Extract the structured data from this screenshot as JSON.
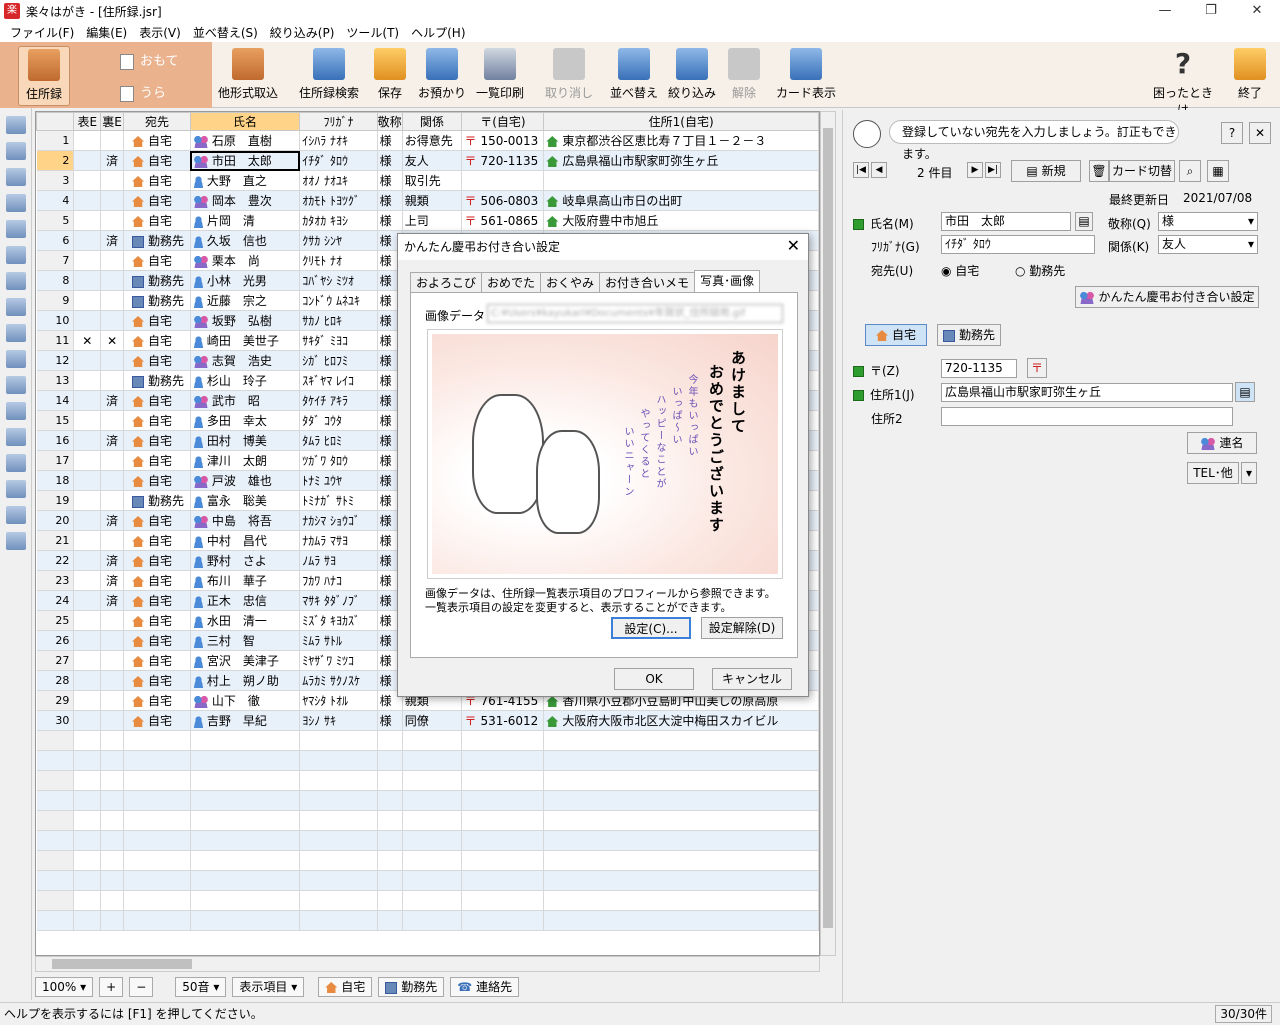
{
  "window": {
    "title": "楽々はがき - [住所録.jsr]",
    "min": "—",
    "max": "❐",
    "close": "✕"
  },
  "menu": [
    "ファイル(F)",
    "編集(E)",
    "表示(V)",
    "並べ替え(S)",
    "絞り込み(P)",
    "ツール(T)",
    "ヘルプ(H)"
  ],
  "ribbon": {
    "jusho": "住所録",
    "omote": "おもて",
    "ura": "うら",
    "tagata": "他形式取込",
    "kensaku": "住所録検索",
    "hozon": "保存",
    "oazukari": "お預かり",
    "ichiran": "一覧印刷",
    "torikeshi": "取り消し",
    "narabekae": "並べ替え",
    "shiborikomi": "絞り込み",
    "kaijo": "解除",
    "card": "カード表示",
    "komatta": "困ったときは",
    "shuryo": "終了"
  },
  "grid": {
    "headers": [
      "",
      "表E",
      "裏E",
      "宛先",
      "氏名",
      "ﾌﾘｶﾞﾅ",
      "敬称",
      "関係",
      "〒(自宅)",
      "住所1(自宅)"
    ],
    "rows": [
      {
        "n": "1",
        "omote": "",
        "ura": "",
        "dest": "自宅",
        "dtype": "h",
        "pt": "g",
        "name": "石原　直樹",
        "kana": "ｲｼﾊﾗ ﾅｵｷ",
        "hon": "様",
        "rel": "お得意先",
        "zip": "150-0013",
        "addr": "東京都渋谷区恵比寿７丁目１－２－３"
      },
      {
        "n": "2",
        "omote": "",
        "ura": "済",
        "dest": "自宅",
        "dtype": "h",
        "pt": "g",
        "name": "市田　太郎",
        "kana": "ｲﾁﾀﾞ ﾀﾛｳ",
        "hon": "様",
        "rel": "友人",
        "zip": "720-1135",
        "addr": "広島県福山市駅家町弥生ヶ丘"
      },
      {
        "n": "3",
        "omote": "",
        "ura": "",
        "dest": "自宅",
        "dtype": "h",
        "pt": "m",
        "name": "大野　直之",
        "kana": "ｵｵﾉ ﾅｵﾕｷ",
        "hon": "様",
        "rel": "取引先",
        "zip": "",
        "addr": ""
      },
      {
        "n": "4",
        "omote": "",
        "ura": "",
        "dest": "自宅",
        "dtype": "h",
        "pt": "g",
        "name": "岡本　豊次",
        "kana": "ｵｶﾓﾄ ﾄﾖﾂｸﾞ",
        "hon": "様",
        "rel": "親類",
        "zip": "506-0803",
        "addr": "岐阜県高山市日の出町"
      },
      {
        "n": "5",
        "omote": "",
        "ura": "",
        "dest": "自宅",
        "dtype": "h",
        "pt": "m",
        "name": "片岡　清",
        "kana": "ｶﾀｵｶ ｷﾖｼ",
        "hon": "様",
        "rel": "上司",
        "zip": "561-0865",
        "addr": "大阪府豊中市旭丘"
      },
      {
        "n": "6",
        "omote": "",
        "ura": "済",
        "dest": "勤務先",
        "dtype": "w",
        "pt": "m",
        "name": "久坂　信也",
        "kana": "ｸｻｶ ｼﾝﾔ",
        "hon": "様",
        "rel": "",
        "zip": "",
        "addr": ""
      },
      {
        "n": "7",
        "omote": "",
        "ura": "",
        "dest": "自宅",
        "dtype": "h",
        "pt": "g",
        "name": "栗本　尚",
        "kana": "ｸﾘﾓﾄ ﾅｵ",
        "hon": "様",
        "rel": "",
        "zip": "",
        "addr": ""
      },
      {
        "n": "8",
        "omote": "",
        "ura": "",
        "dest": "勤務先",
        "dtype": "w",
        "pt": "m",
        "name": "小林　光男",
        "kana": "ｺﾊﾞﾔｼ ﾐﾂｵ",
        "hon": "様",
        "rel": "",
        "zip": "",
        "addr": ""
      },
      {
        "n": "9",
        "omote": "",
        "ura": "",
        "dest": "勤務先",
        "dtype": "w",
        "pt": "m",
        "name": "近藤　宗之",
        "kana": "ｺﾝﾄﾞｳ ﾑﾈﾕｷ",
        "hon": "様",
        "rel": "",
        "zip": "",
        "addr": ""
      },
      {
        "n": "10",
        "omote": "",
        "ura": "",
        "dest": "自宅",
        "dtype": "h",
        "pt": "g",
        "name": "坂野　弘樹",
        "kana": "ｻｶﾉ ﾋﾛｷ",
        "hon": "様",
        "rel": "",
        "zip": "",
        "addr": ""
      },
      {
        "n": "11",
        "omote": "✕",
        "ura": "✕",
        "dest": "自宅",
        "dtype": "h",
        "pt": "m",
        "name": "崎田　美世子",
        "kana": "ｻｷﾀﾞ ﾐﾖｺ",
        "hon": "様",
        "rel": "",
        "zip": "",
        "addr": ""
      },
      {
        "n": "12",
        "omote": "",
        "ura": "",
        "dest": "自宅",
        "dtype": "h",
        "pt": "g",
        "name": "志賀　浩史",
        "kana": "ｼｶﾞ ﾋﾛﾌﾐ",
        "hon": "様",
        "rel": "",
        "zip": "",
        "addr": ""
      },
      {
        "n": "13",
        "omote": "",
        "ura": "",
        "dest": "勤務先",
        "dtype": "w",
        "pt": "m",
        "name": "杉山　玲子",
        "kana": "ｽｷﾞﾔﾏ ﾚｲｺ",
        "hon": "様",
        "rel": "",
        "zip": "",
        "addr": ""
      },
      {
        "n": "14",
        "omote": "",
        "ura": "済",
        "dest": "自宅",
        "dtype": "h",
        "pt": "g",
        "name": "武市　昭",
        "kana": "ﾀｹｲﾁ ｱｷﾗ",
        "hon": "様",
        "rel": "",
        "zip": "",
        "addr": ""
      },
      {
        "n": "15",
        "omote": "",
        "ura": "",
        "dest": "自宅",
        "dtype": "h",
        "pt": "m",
        "name": "多田　幸太",
        "kana": "ﾀﾀﾞ ｺｳﾀ",
        "hon": "様",
        "rel": "",
        "zip": "",
        "addr": ""
      },
      {
        "n": "16",
        "omote": "",
        "ura": "済",
        "dest": "自宅",
        "dtype": "h",
        "pt": "m",
        "name": "田村　博美",
        "kana": "ﾀﾑﾗ ﾋﾛﾐ",
        "hon": "様",
        "rel": "",
        "zip": "",
        "addr": ""
      },
      {
        "n": "17",
        "omote": "",
        "ura": "",
        "dest": "自宅",
        "dtype": "h",
        "pt": "m",
        "name": "津川　太朗",
        "kana": "ﾂｶﾞﾜ ﾀﾛｳ",
        "hon": "様",
        "rel": "",
        "zip": "",
        "addr": ""
      },
      {
        "n": "18",
        "omote": "",
        "ura": "",
        "dest": "自宅",
        "dtype": "h",
        "pt": "g",
        "name": "戸波　雄也",
        "kana": "ﾄﾅﾐ ﾕｳﾔ",
        "hon": "様",
        "rel": "",
        "zip": "",
        "addr": ""
      },
      {
        "n": "19",
        "omote": "",
        "ura": "",
        "dest": "勤務先",
        "dtype": "w",
        "pt": "m",
        "name": "富永　聡美",
        "kana": "ﾄﾐﾅｶﾞ ｻﾄﾐ",
        "hon": "様",
        "rel": "",
        "zip": "",
        "addr": ""
      },
      {
        "n": "20",
        "omote": "",
        "ura": "済",
        "dest": "自宅",
        "dtype": "h",
        "pt": "g",
        "name": "中島　将吾",
        "kana": "ﾅｶｼﾏ ｼｮｳｺﾞ",
        "hon": "様",
        "rel": "",
        "zip": "",
        "addr": ""
      },
      {
        "n": "21",
        "omote": "",
        "ura": "",
        "dest": "自宅",
        "dtype": "h",
        "pt": "m",
        "name": "中村　昌代",
        "kana": "ﾅｶﾑﾗ ﾏｻﾖ",
        "hon": "様",
        "rel": "",
        "zip": "",
        "addr": ""
      },
      {
        "n": "22",
        "omote": "",
        "ura": "済",
        "dest": "自宅",
        "dtype": "h",
        "pt": "m",
        "name": "野村　さよ",
        "kana": "ﾉﾑﾗ ｻﾖ",
        "hon": "様",
        "rel": "",
        "zip": "",
        "addr": ""
      },
      {
        "n": "23",
        "omote": "",
        "ura": "済",
        "dest": "自宅",
        "dtype": "h",
        "pt": "m",
        "name": "布川　華子",
        "kana": "ﾌｶﾜ ﾊﾅｺ",
        "hon": "様",
        "rel": "",
        "zip": "",
        "addr": ""
      },
      {
        "n": "24",
        "omote": "",
        "ura": "済",
        "dest": "自宅",
        "dtype": "h",
        "pt": "m",
        "name": "正木　忠信",
        "kana": "ﾏｻｷ ﾀﾀﾞﾉﾌﾞ",
        "hon": "様",
        "rel": "",
        "zip": "",
        "addr": ""
      },
      {
        "n": "25",
        "omote": "",
        "ura": "",
        "dest": "自宅",
        "dtype": "h",
        "pt": "m",
        "name": "水田　清一",
        "kana": "ﾐｽﾞﾀ ｷﾖｶｽﾞ",
        "hon": "様",
        "rel": "",
        "zip": "",
        "addr": ""
      },
      {
        "n": "26",
        "omote": "",
        "ura": "",
        "dest": "自宅",
        "dtype": "h",
        "pt": "m",
        "name": "三村　智",
        "kana": "ﾐﾑﾗ ｻﾄﾙ",
        "hon": "様",
        "rel": "",
        "zip": "",
        "addr": ""
      },
      {
        "n": "27",
        "omote": "",
        "ura": "",
        "dest": "自宅",
        "dtype": "h",
        "pt": "m",
        "name": "宮沢　美津子",
        "kana": "ﾐﾔｻﾞﾜ ﾐﾂｺ",
        "hon": "様",
        "rel": "",
        "zip": "",
        "addr": ""
      },
      {
        "n": "28",
        "omote": "",
        "ura": "",
        "dest": "自宅",
        "dtype": "h",
        "pt": "m",
        "name": "村上　朔ノ助",
        "kana": "ﾑﾗｶﾐ ｻｸﾉｽｹ",
        "hon": "様",
        "rel": "",
        "zip": "",
        "addr": ""
      },
      {
        "n": "29",
        "omote": "",
        "ura": "",
        "dest": "自宅",
        "dtype": "h",
        "pt": "g",
        "name": "山下　徹",
        "kana": "ﾔﾏｼﾀ ﾄｵﾙ",
        "hon": "様",
        "rel": "親類",
        "zip": "761-4155",
        "addr": "香川県小豆郡小豆島町中山美しの原高原"
      },
      {
        "n": "30",
        "omote": "",
        "ura": "",
        "dest": "自宅",
        "dtype": "h",
        "pt": "m",
        "name": "吉野　早紀",
        "kana": "ﾖｼﾉ ｻｷ",
        "hon": "様",
        "rel": "同僚",
        "zip": "531-6012",
        "addr": "大阪府大阪市北区大淀中梅田スカイビル"
      }
    ]
  },
  "bottom": {
    "zoom": "100%",
    "zoom_in": "+",
    "zoom_out": "−",
    "sort": "50音",
    "display": "表示項目",
    "home": "自宅",
    "work": "勤務先",
    "contact": "連絡先"
  },
  "status": {
    "text": "ヘルプを表示するには [F1] を押してください。",
    "count": "30/30件"
  },
  "right": {
    "hint": "登録していない宛先を入力しましょう。訂正もできます。",
    "help": "?",
    "close": "✕",
    "record": "2 件目",
    "new": "新規",
    "card_switch": "カード切替",
    "updated_label": "最終更新日",
    "updated": "2021/07/08",
    "name_label": "氏名(M)",
    "name": "市田　太郎",
    "honor_label": "敬称(Q)",
    "honor": "様",
    "kana_label": "ﾌﾘｶﾞﾅ(G)",
    "kana": "ｲﾁﾀﾞ ﾀﾛｳ",
    "rel_label": "関係(K)",
    "rel": "友人",
    "dest_label": "宛先(U)",
    "dest_home": "自宅",
    "dest_work": "勤務先",
    "kantan": "かんたん慶弔お付き合い設定",
    "tab_home": "自宅",
    "tab_work": "勤務先",
    "zip_label": "〒(Z)",
    "zip": "720-1135",
    "addr1_label": "住所1(J)",
    "addr1": "広島県福山市駅家町弥生ヶ丘",
    "addr2_label": "住所2",
    "addr2": "",
    "renmei": "連名",
    "tel": "TEL･他"
  },
  "dialog": {
    "title": "かんたん慶弔お付き合い設定",
    "tabs": [
      "およろこび",
      "おめでた",
      "おくやみ",
      "お付き合いメモ",
      "写真･画像"
    ],
    "img_label": "画像データ",
    "img_path": "C:¥Users¥kayukari¥Documents¥年賀状_住所録用.gif",
    "card_title": "あけまして",
    "card_title2": "おめでとうございます",
    "card_msg": [
      "今年もいっぱい",
      "いっぱ〜い",
      "ハッピーなことが",
      "やってくると",
      "いいニャーン"
    ],
    "note1": "画像データは、住所録一覧表示項目のプロフィールから参照できます。",
    "note2": "一覧表示項目の設定を変更すると、表示することができます。",
    "set": "設定(C)...",
    "unset": "設定解除(D)",
    "ok": "OK",
    "cancel": "キャンセル"
  }
}
